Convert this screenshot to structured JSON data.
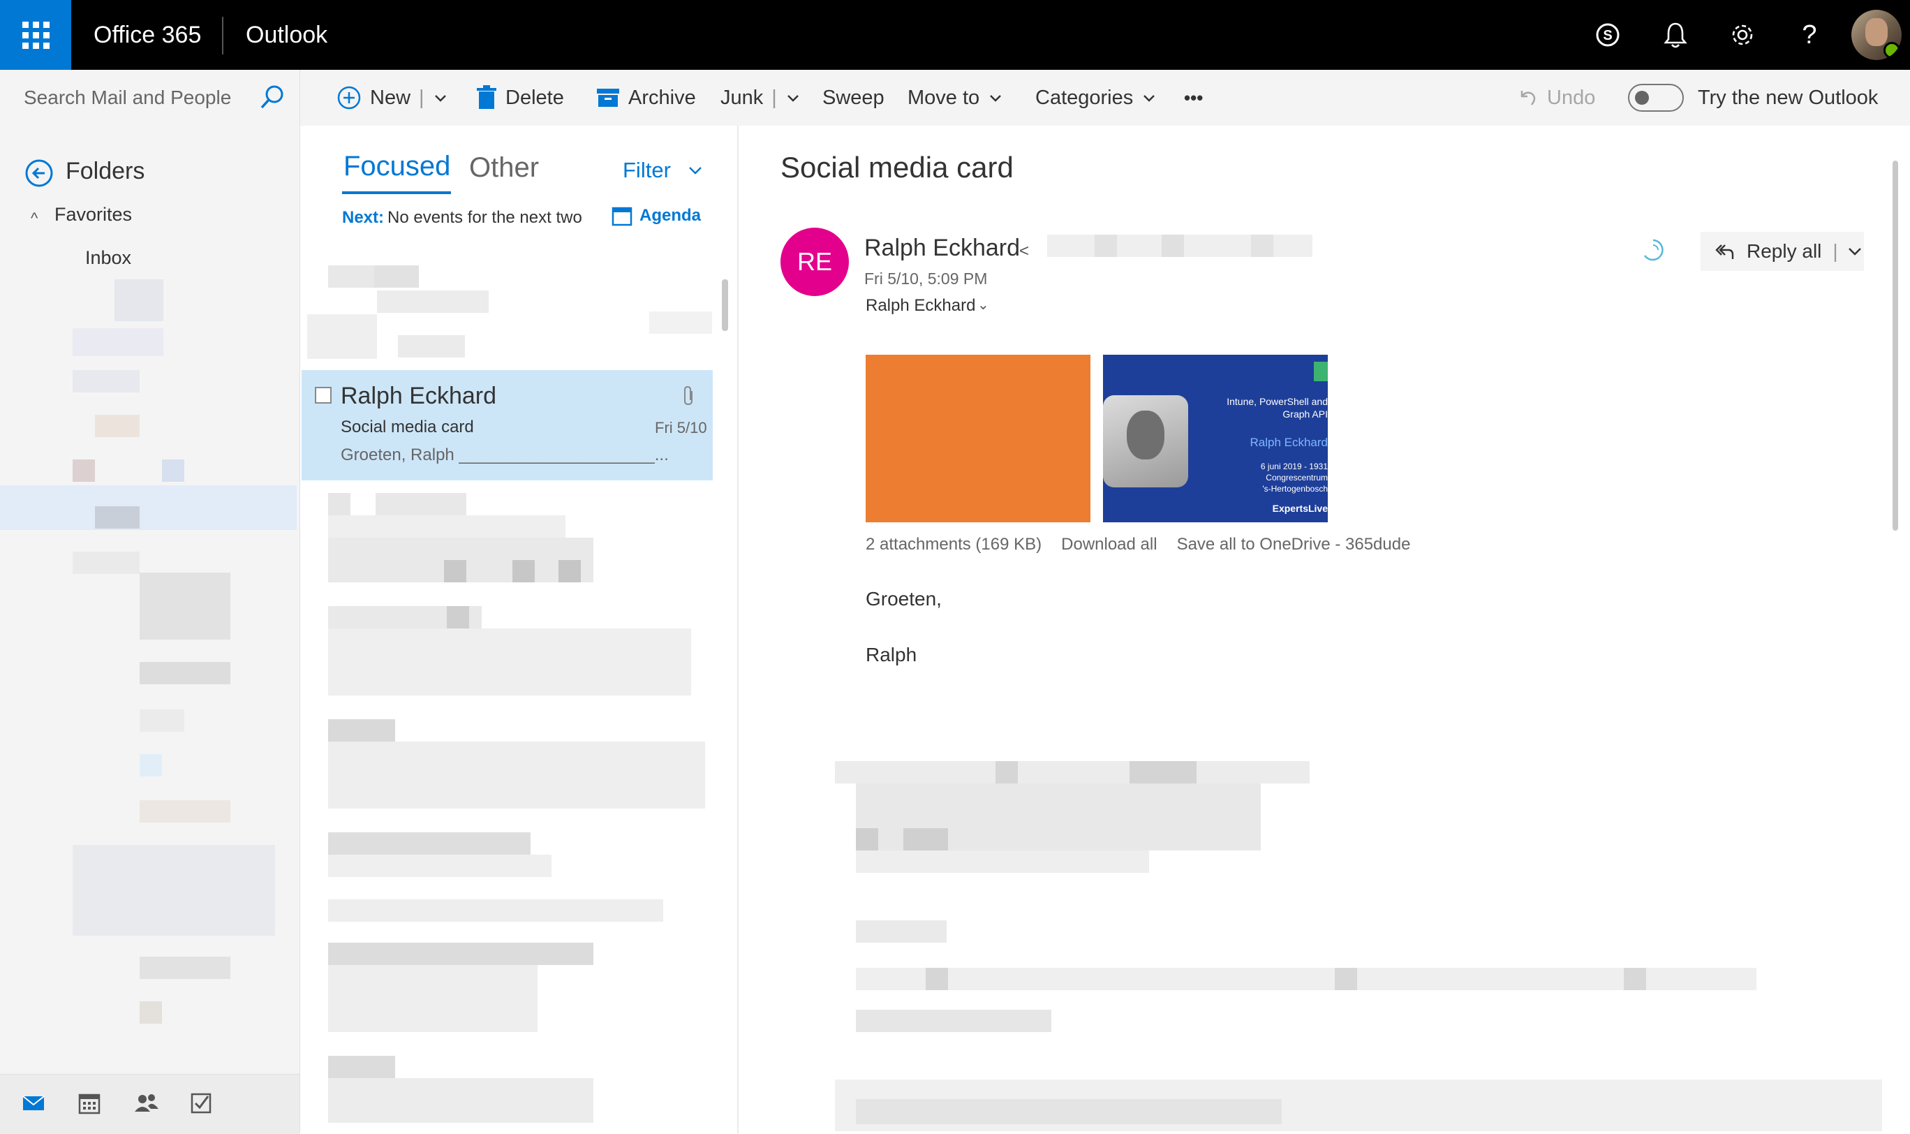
{
  "topbar": {
    "brand": "Office 365",
    "app": "Outlook",
    "icons": [
      "waffle-icon",
      "skype-icon",
      "bell-icon",
      "gear-icon",
      "help-icon",
      "avatar"
    ]
  },
  "nav": {
    "search_placeholder": "Search Mail and People",
    "folders_label": "Folders",
    "favorites_label": "Favorites",
    "inbox_label": "Inbox",
    "bottom_icons": [
      "mail-icon",
      "calendar-icon",
      "people-icon",
      "tasks-icon"
    ]
  },
  "commands": {
    "new": "New",
    "delete": "Delete",
    "archive": "Archive",
    "junk": "Junk",
    "sweep": "Sweep",
    "move_to": "Move to",
    "categories": "Categories",
    "more": "•••",
    "undo": "Undo",
    "try_new": "Try the new Outlook"
  },
  "list": {
    "tab_focused": "Focused",
    "tab_other": "Other",
    "filter": "Filter",
    "next_label": "Next:",
    "next_text": "No events for the next two",
    "agenda": "Agenda",
    "selected": {
      "sender": "Ralph Eckhard",
      "subject": "Social media card",
      "date": "Fri 5/10",
      "preview": "Groeten,  Ralph _____________________..."
    }
  },
  "reading": {
    "subject": "Social media card",
    "sender_initials": "RE",
    "sender_name": "Ralph Eckhard",
    "sender_caret": "<",
    "sent": "Fri 5/10, 5:09 PM",
    "to": "Ralph Eckhard",
    "reply_all": "Reply all",
    "attachment_card": {
      "title": "Intune, PowerShell and Graph API",
      "speaker": "Ralph Eckhard",
      "event_line1": "6 juni 2019 - 1931 Congrescentrum",
      "event_line2": "'s-Hertogenbosch",
      "logo": "ExpertsLive"
    },
    "attachments_info": "2 attachments (169 KB)",
    "download_all": "Download all",
    "save_onedrive": "Save all to OneDrive - 365dude",
    "body_greeting": "Groeten,",
    "body_name": "Ralph"
  },
  "colors": {
    "accent": "#0078d4",
    "topbar": "#000000",
    "avatar_bg": "#e3008c",
    "selected_row": "#cde6f7",
    "attachment_orange": "#ed7d31",
    "attachment_blue": "#1e3f99"
  }
}
